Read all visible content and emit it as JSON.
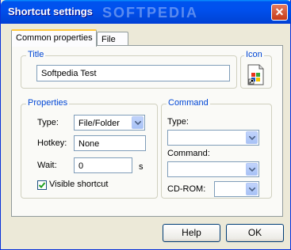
{
  "window": {
    "title": "Shortcut settings",
    "watermark": "SOFTPEDIA"
  },
  "tabs": [
    {
      "label": "Common properties",
      "active": true
    },
    {
      "label": "File",
      "active": false
    }
  ],
  "title_group": {
    "label": "Title",
    "value": "Softpedia Test"
  },
  "icon_group": {
    "label": "Icon",
    "icon": "shortcut-file-icon"
  },
  "properties": {
    "label": "Properties",
    "type_label": "Type:",
    "type_value": "File/Folder",
    "hotkey_label": "Hotkey:",
    "hotkey_value": "None",
    "wait_label": "Wait:",
    "wait_value": "0",
    "wait_unit": "s",
    "visible_label": "Visible shortcut",
    "visible_checked": true
  },
  "command": {
    "label": "Command",
    "type_label": "Type:",
    "type_value": "",
    "command_label": "Command:",
    "command_value": "",
    "cdrom_label": "CD-ROM:",
    "cdrom_value": ""
  },
  "buttons": {
    "help": "Help",
    "ok": "OK"
  }
}
